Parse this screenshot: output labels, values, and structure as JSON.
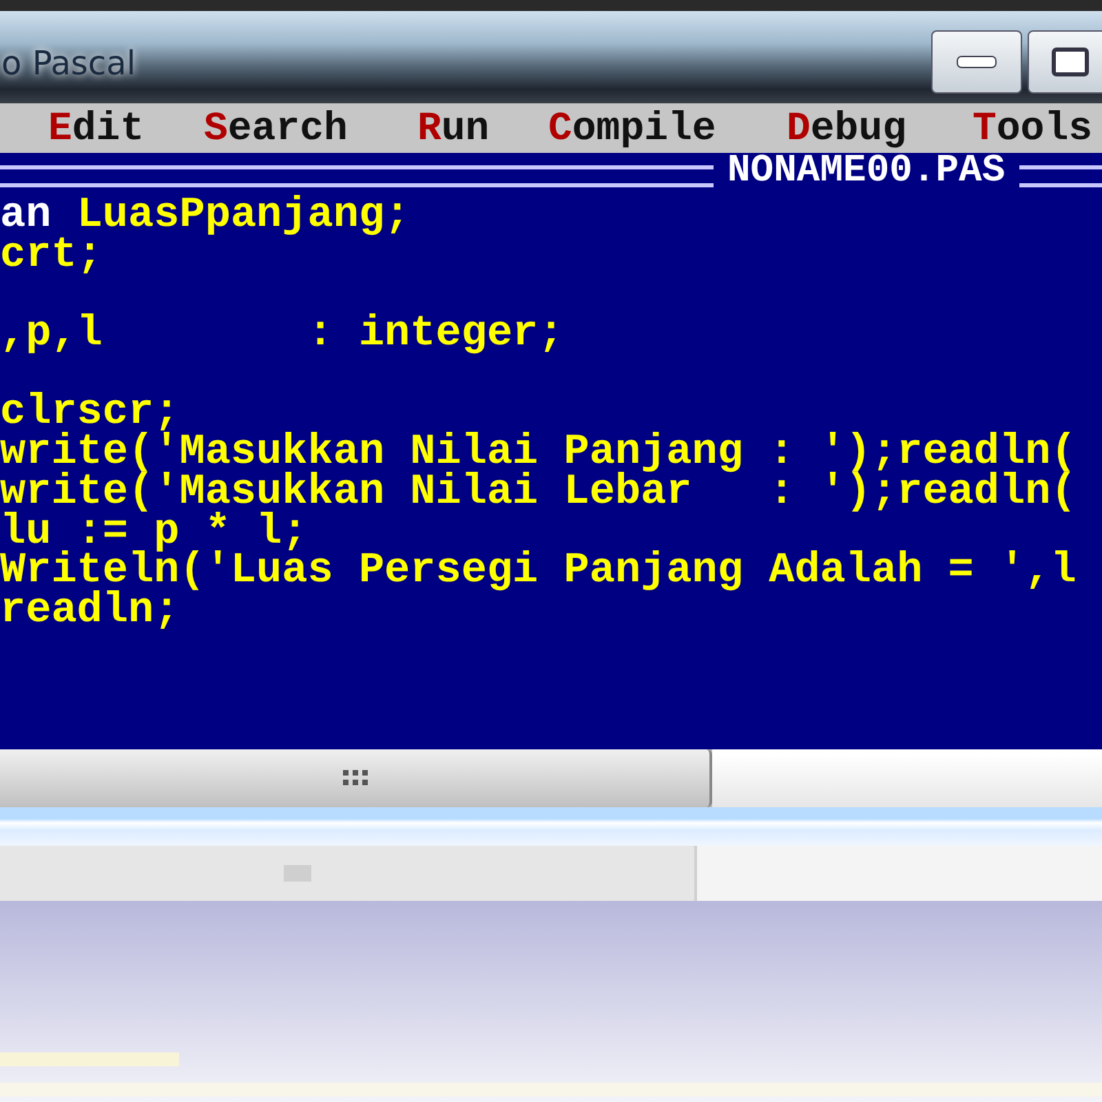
{
  "window": {
    "title": "o Pascal"
  },
  "menu": [
    {
      "label": "Edit"
    },
    {
      "label": "Search"
    },
    {
      "label": "Run"
    },
    {
      "label": "Compile"
    },
    {
      "label": "Debug"
    },
    {
      "label": "Tools"
    }
  ],
  "editor": {
    "file_name": "NONAME00.PAS",
    "lines": [
      [
        {
          "text": "an",
          "kind": "keyword"
        },
        {
          "text": " LuasPpanjang;",
          "kind": "plain"
        }
      ],
      [
        {
          "text": "crt;",
          "kind": "plain"
        }
      ],
      [
        {
          "kind": "blank"
        }
      ],
      [
        {
          "text": ",p,l        : integer;",
          "kind": "plain"
        }
      ],
      [
        {
          "kind": "blank"
        }
      ],
      [
        {
          "text": "clrscr;",
          "kind": "plain"
        }
      ],
      [
        {
          "text": "write('Masukkan Nilai Panjang : ');readln(",
          "kind": "plain"
        }
      ],
      [
        {
          "text": "write('Masukkan Nilai Lebar   : ');readln(",
          "kind": "plain"
        }
      ],
      [
        {
          "text": "lu := p * l;",
          "kind": "plain"
        }
      ],
      [
        {
          "text": "Writeln('Luas Persegi Panjang Adalah = ',l",
          "kind": "plain"
        }
      ],
      [
        {
          "text": "readln;",
          "kind": "plain"
        }
      ]
    ]
  }
}
